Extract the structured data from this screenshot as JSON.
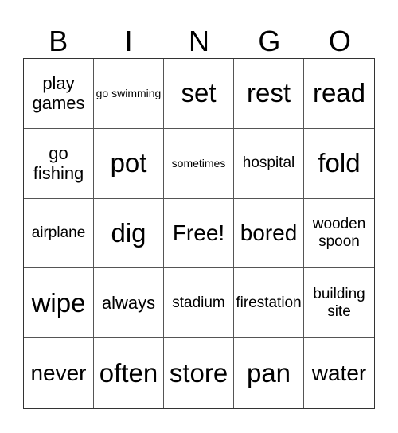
{
  "header": [
    "B",
    "I",
    "N",
    "G",
    "O"
  ],
  "cells": [
    {
      "text": "play games",
      "size": "md"
    },
    {
      "text": "go swimming",
      "size": "xs"
    },
    {
      "text": "set",
      "size": "xl"
    },
    {
      "text": "rest",
      "size": "xl"
    },
    {
      "text": "read",
      "size": "xl"
    },
    {
      "text": "go fishing",
      "size": "md"
    },
    {
      "text": "pot",
      "size": "xl"
    },
    {
      "text": "sometimes",
      "size": "xs"
    },
    {
      "text": "hospital",
      "size": "sm"
    },
    {
      "text": "fold",
      "size": "xl"
    },
    {
      "text": "airplane",
      "size": "sm"
    },
    {
      "text": "dig",
      "size": "xl"
    },
    {
      "text": "Free!",
      "size": "lg"
    },
    {
      "text": "bored",
      "size": "lg"
    },
    {
      "text": "wooden spoon",
      "size": "sm"
    },
    {
      "text": "wipe",
      "size": "xl"
    },
    {
      "text": "always",
      "size": "md"
    },
    {
      "text": "stadium",
      "size": "sm"
    },
    {
      "text": "firestation",
      "size": "sm"
    },
    {
      "text": "building site",
      "size": "sm"
    },
    {
      "text": "never",
      "size": "lg"
    },
    {
      "text": "often",
      "size": "xl"
    },
    {
      "text": "store",
      "size": "xl"
    },
    {
      "text": "pan",
      "size": "xl"
    },
    {
      "text": "water",
      "size": "lg"
    }
  ]
}
